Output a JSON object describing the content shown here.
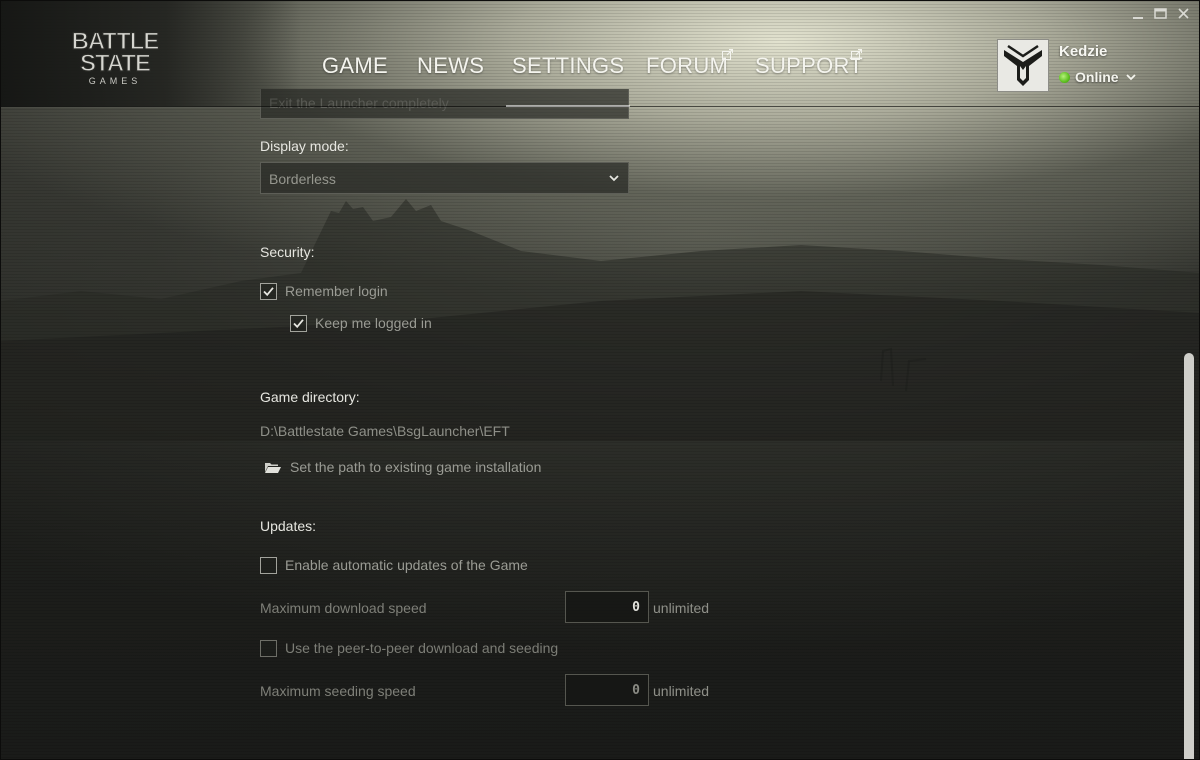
{
  "brand": {
    "logo_line1": "BATTLE",
    "logo_line2": "STATE",
    "logo_line3": "GAMES"
  },
  "nav": {
    "items": [
      {
        "label": "GAME",
        "external": false,
        "active": false
      },
      {
        "label": "NEWS",
        "external": false,
        "active": false
      },
      {
        "label": "SETTINGS",
        "external": false,
        "active": true
      },
      {
        "label": "FORUM",
        "external": true,
        "active": false
      },
      {
        "label": "SUPPORT",
        "external": true,
        "active": false
      }
    ]
  },
  "profile": {
    "username": "Kedzie",
    "status": "Online",
    "status_color": "#5cbf1f",
    "avatar_icon": "faction-emblem-icon"
  },
  "settings": {
    "launcher_action_value": "Exit the Launcher completely",
    "display_mode": {
      "label": "Display mode:",
      "value": "Borderless"
    },
    "security": {
      "label": "Security:",
      "remember_login": {
        "label": "Remember login",
        "checked": true
      },
      "keep_logged_in": {
        "label": "Keep me logged in",
        "checked": true
      }
    },
    "game_directory": {
      "label": "Game directory:",
      "path": "D:\\Battlestate Games\\BsgLauncher\\EFT",
      "set_path_label": "Set the path to existing game installation",
      "set_path_icon": "folder-open-icon"
    },
    "updates": {
      "label": "Updates:",
      "auto_updates": {
        "label": "Enable automatic updates of the Game",
        "checked": false
      },
      "max_download": {
        "label": "Maximum download speed",
        "value": "0",
        "unit": "unlimited"
      },
      "p2p": {
        "label": "Use the peer-to-peer download and seeding",
        "checked": false
      },
      "max_seeding": {
        "label": "Maximum seeding speed",
        "value": "0",
        "unit": "unlimited"
      }
    }
  },
  "colors": {
    "accent_text": "#f4f4ee",
    "muted_text": "#8e8f88",
    "online_green": "#5cbf1f"
  }
}
